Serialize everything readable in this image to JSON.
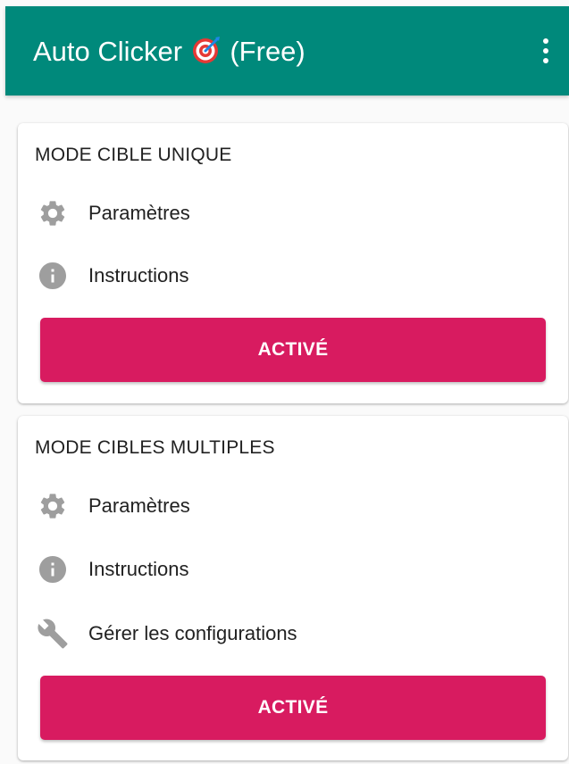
{
  "app_bar": {
    "title_prefix": "Auto Clicker",
    "title_emoji": "target-emoji",
    "title_suffix": "(Free)",
    "more_icon": "more-vert-icon",
    "color": "#00897b"
  },
  "single_mode": {
    "title": "MODE CIBLE UNIQUE",
    "items": [
      {
        "icon": "gear-icon",
        "label": "Paramètres"
      },
      {
        "icon": "info-icon",
        "label": "Instructions"
      }
    ],
    "button_label": "ACTIVÉ"
  },
  "multi_mode": {
    "title": "MODE CIBLES MULTIPLES",
    "items": [
      {
        "icon": "gear-icon",
        "label": "Paramètres"
      },
      {
        "icon": "info-icon",
        "label": "Instructions"
      },
      {
        "icon": "wrench-icon",
        "label": "Gérer les configurations"
      }
    ],
    "button_label": "ACTIVÉ"
  },
  "colors": {
    "accent": "#d81b60",
    "icon_gray": "#9e9e9e"
  }
}
